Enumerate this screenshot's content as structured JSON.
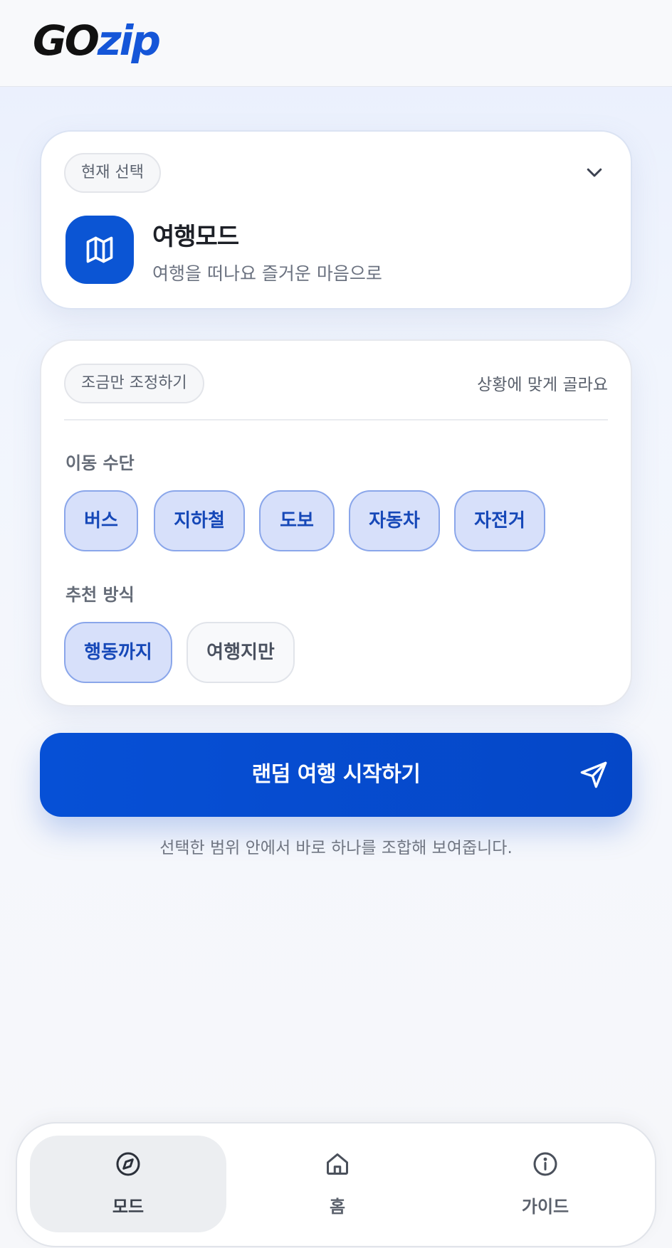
{
  "header": {
    "logo_part1": "GO",
    "logo_part2": "zip"
  },
  "mode_card": {
    "current_label": "현재 선택",
    "title": "여행모드",
    "subtitle": "여행을 떠나요 즐거운 마음으로",
    "icon": "map-icon",
    "accent": "#0b55d4"
  },
  "adjust_card": {
    "label": "조금만 조정하기",
    "hint": "상황에 맞게 골라요",
    "transport": {
      "title": "이동 수단",
      "options": [
        {
          "label": "버스",
          "selected": true
        },
        {
          "label": "지하철",
          "selected": true
        },
        {
          "label": "도보",
          "selected": true
        },
        {
          "label": "자동차",
          "selected": true
        },
        {
          "label": "자전거",
          "selected": true
        }
      ]
    },
    "recommend": {
      "title": "추천 방식",
      "options": [
        {
          "label": "행동까지",
          "selected": true
        },
        {
          "label": "여행지만",
          "selected": false
        }
      ]
    }
  },
  "start": {
    "label": "랜덤 여행 시작하기",
    "icon": "send-icon",
    "note": "선택한 범위 안에서 바로 하나를 조합해 보여줍니다."
  },
  "nav": {
    "items": [
      {
        "label": "모드",
        "icon": "compass-icon",
        "active": true
      },
      {
        "label": "홈",
        "icon": "home-icon",
        "active": false
      },
      {
        "label": "가이드",
        "icon": "info-icon",
        "active": false
      }
    ]
  }
}
